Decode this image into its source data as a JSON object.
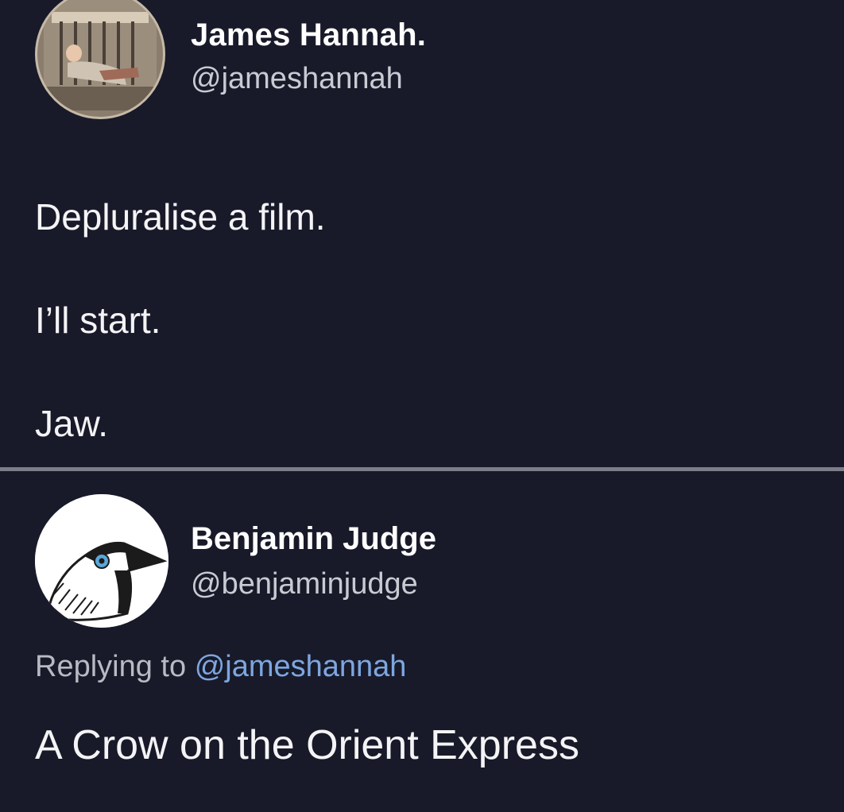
{
  "original_tweet": {
    "display_name": "James Hannah.",
    "handle": "@jameshannah",
    "lines": [
      "Depluralise a film.",
      "I’ll start.",
      "Jaw."
    ],
    "avatar_icon": "profile-photo"
  },
  "reply_tweet": {
    "display_name": "Benjamin Judge",
    "handle": "@benjaminjudge",
    "replying_prefix": "Replying to",
    "replying_handle": "@jameshannah",
    "text": "A Crow on the Orient Express",
    "avatar_icon": "crow-icon"
  },
  "colors": {
    "background": "#181a29",
    "divider": "#7b7e89",
    "link": "#7ea6e0"
  }
}
